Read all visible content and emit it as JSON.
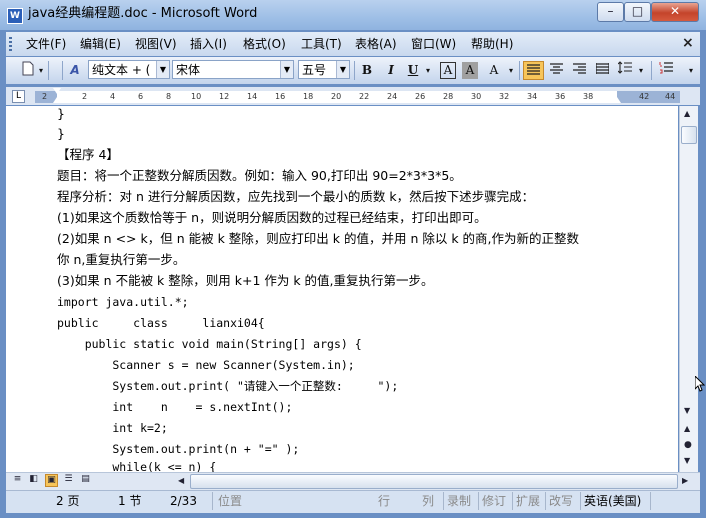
{
  "window": {
    "title": "java经典编程题.doc - Microsoft Word",
    "app_icon": "word-doc-icon",
    "controls": {
      "minimize": "–",
      "maximize": "□",
      "close": "✕"
    }
  },
  "menu": {
    "items": [
      "文件(F)",
      "编辑(E)",
      "视图(V)",
      "插入(I)",
      "格式(O)",
      "工具(T)",
      "表格(A)",
      "窗口(W)",
      "帮助(H)"
    ],
    "close_label": "×"
  },
  "toolbar": {
    "style_value": "纯文本 + (",
    "font_value": "宋体",
    "size_value": "五号",
    "bold": "B",
    "italic": "I",
    "underline": "U",
    "char_border": "A",
    "char_shading": "A",
    "paragraph_mark": "A",
    "active_alignment": "justify"
  },
  "ruler": {
    "ticks": [
      "2",
      "2",
      "4",
      "6",
      "8",
      "10",
      "12",
      "14",
      "16",
      "18",
      "20",
      "22",
      "24",
      "26",
      "28",
      "30",
      "32",
      "34",
      "36",
      "38",
      "42",
      "44"
    ],
    "tab_selector": "L"
  },
  "document": {
    "lines": [
      "}",
      "}",
      "【程序 4】",
      "题目：将一个正整数分解质因数。例如：输入 90,打印出 90=2*3*3*5。",
      "程序分析：对 n 进行分解质因数，应先找到一个最小的质数 k，然后按下述步骤完成：",
      "(1)如果这个质数恰等于 n，则说明分解质因数的过程已经结束，打印出即可。",
      "(2)如果 n <> k，但 n 能被 k 整除，则应打印出 k 的值，并用 n 除以 k 的商,作为新的正整数",
      "你 n,重复执行第一步。",
      "(3)如果 n 不能被 k 整除，则用 k+1 作为 k 的值,重复执行第一步。",
      "import java.util.*;",
      "public     class     lianxi04{",
      "    public static void main(String[] args) {",
      "        Scanner s = new Scanner(System.in);",
      "        System.out.print( \"请键入一个正整数:     \");",
      "        int    n    = s.nextInt();",
      "        int k=2;",
      "        System.out.print(n + \"=\" );",
      "        while(k <= n) {"
    ]
  },
  "statusbar": {
    "page": "2 页",
    "section": "1 节",
    "pages": "2/33",
    "position": "位置",
    "line": "行",
    "column": "列",
    "record": "录制",
    "revision": "修订",
    "extend": "扩展",
    "overtype": "改写",
    "language": "英语(美国)"
  }
}
